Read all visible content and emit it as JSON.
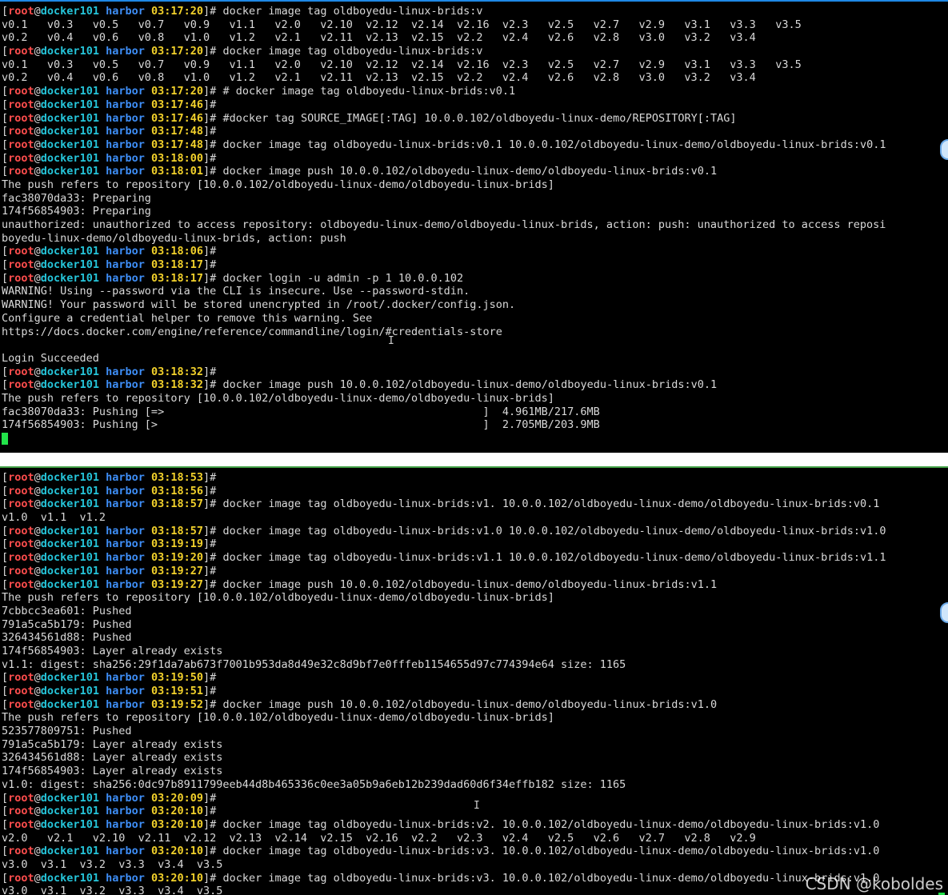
{
  "prompt": {
    "open": "[",
    "user": "root",
    "at": "@",
    "host": "docker101",
    "dir": "harbor",
    "close": "]#"
  },
  "panes": [
    {
      "name": "top",
      "lines": [
        {
          "t": "03:17:20",
          "c": " docker image tag oldboyedu-linux-brids:v"
        },
        {
          "o": "v0.1   v0.3   v0.5   v0.7   v0.9   v1.1   v2.0   v2.10  v2.12  v2.14  v2.16  v2.3   v2.5   v2.7   v2.9   v3.1   v3.3   v3.5"
        },
        {
          "o": "v0.2   v0.4   v0.6   v0.8   v1.0   v1.2   v2.1   v2.11  v2.13  v2.15  v2.2   v2.4   v2.6   v2.8   v3.0   v3.2   v3.4"
        },
        {
          "t": "03:17:20",
          "c": " docker image tag oldboyedu-linux-brids:v"
        },
        {
          "o": "v0.1   v0.3   v0.5   v0.7   v0.9   v1.1   v2.0   v2.10  v2.12  v2.14  v2.16  v2.3   v2.5   v2.7   v2.9   v3.1   v3.3   v3.5"
        },
        {
          "o": "v0.2   v0.4   v0.6   v0.8   v1.0   v1.2   v2.1   v2.11  v2.13  v2.15  v2.2   v2.4   v2.6   v2.8   v3.0   v3.2   v3.4"
        },
        {
          "t": "03:17:20",
          "c": " # docker image tag oldboyedu-linux-brids:v0.1"
        },
        {
          "t": "03:17:46",
          "c": ""
        },
        {
          "t": "03:17:46",
          "c": " #docker tag SOURCE_IMAGE[:TAG] 10.0.0.102/oldboyedu-linux-demo/REPOSITORY[:TAG]"
        },
        {
          "t": "03:17:48",
          "c": ""
        },
        {
          "t": "03:17:48",
          "c": " docker image tag oldboyedu-linux-brids:v0.1 10.0.0.102/oldboyedu-linux-demo/oldboyedu-linux-brids:v0.1"
        },
        {
          "t": "03:18:00",
          "c": ""
        },
        {
          "t": "03:18:01",
          "c": " docker image push 10.0.0.102/oldboyedu-linux-demo/oldboyedu-linux-brids:v0.1"
        },
        {
          "o": "The push refers to repository [10.0.0.102/oldboyedu-linux-demo/oldboyedu-linux-brids]"
        },
        {
          "o": "fac38070da33: Preparing"
        },
        {
          "o": "174f56854903: Preparing"
        },
        {
          "o": "unauthorized: unauthorized to access repository: oldboyedu-linux-demo/oldboyedu-linux-brids, action: push: unauthorized to access reposi"
        },
        {
          "o": "boyedu-linux-demo/oldboyedu-linux-brids, action: push"
        },
        {
          "t": "03:18:06",
          "c": ""
        },
        {
          "t": "03:18:17",
          "c": ""
        },
        {
          "t": "03:18:17",
          "c": " docker login -u admin -p 1 10.0.0.102"
        },
        {
          "o": "WARNING! Using --password via the CLI is insecure. Use --password-stdin."
        },
        {
          "o": "WARNING! Your password will be stored unencrypted in /root/.docker/config.json."
        },
        {
          "o": "Configure a credential helper to remove this warning. See"
        },
        {
          "o": "https://docs.docker.com/engine/reference/commandline/login/#credentials-store"
        },
        {
          "o": ""
        },
        {
          "o": "Login Succeeded"
        },
        {
          "t": "03:18:32",
          "c": ""
        },
        {
          "t": "03:18:32",
          "c": " docker image push 10.0.0.102/oldboyedu-linux-demo/oldboyedu-linux-brids:v0.1"
        },
        {
          "o": "The push refers to repository [10.0.0.102/oldboyedu-linux-demo/oldboyedu-linux-brids]"
        },
        {
          "o": "fac38070da33: Pushing [=>                                                 ]  4.961MB/217.6MB"
        },
        {
          "o": "174f56854903: Pushing [>                                                  ]  2.705MB/203.9MB"
        },
        {
          "cursor": true
        }
      ]
    },
    {
      "name": "bottom",
      "lines": [
        {
          "t": "03:18:53",
          "c": ""
        },
        {
          "t": "03:18:56",
          "c": ""
        },
        {
          "t": "03:18:57",
          "c": " docker image tag oldboyedu-linux-brids:v1. 10.0.0.102/oldboyedu-linux-demo/oldboyedu-linux-brids:v0.1"
        },
        {
          "o": "v1.0  v1.1  v1.2"
        },
        {
          "t": "03:18:57",
          "c": " docker image tag oldboyedu-linux-brids:v1.0 10.0.0.102/oldboyedu-linux-demo/oldboyedu-linux-brids:v1.0"
        },
        {
          "t": "03:19:19",
          "c": ""
        },
        {
          "t": "03:19:20",
          "c": " docker image tag oldboyedu-linux-brids:v1.1 10.0.0.102/oldboyedu-linux-demo/oldboyedu-linux-brids:v1.1"
        },
        {
          "t": "03:19:27",
          "c": ""
        },
        {
          "t": "03:19:27",
          "c": " docker image push 10.0.0.102/oldboyedu-linux-demo/oldboyedu-linux-brids:v1.1"
        },
        {
          "o": "The push refers to repository [10.0.0.102/oldboyedu-linux-demo/oldboyedu-linux-brids]"
        },
        {
          "o": "7cbbcc3ea601: Pushed"
        },
        {
          "o": "791a5ca5b179: Pushed"
        },
        {
          "o": "326434561d88: Pushed"
        },
        {
          "o": "174f56854903: Layer already exists"
        },
        {
          "o": "v1.1: digest: sha256:29f1da7ab673f7001b953da8d49e32c8d9bf7e0fffeb1154655d97c774394e64 size: 1165"
        },
        {
          "t": "03:19:50",
          "c": ""
        },
        {
          "t": "03:19:51",
          "c": ""
        },
        {
          "t": "03:19:52",
          "c": " docker image push 10.0.0.102/oldboyedu-linux-demo/oldboyedu-linux-brids:v1.0"
        },
        {
          "o": "The push refers to repository [10.0.0.102/oldboyedu-linux-demo/oldboyedu-linux-brids]"
        },
        {
          "o": "523577809751: Pushed"
        },
        {
          "o": "791a5ca5b179: Layer already exists"
        },
        {
          "o": "326434561d88: Layer already exists"
        },
        {
          "o": "174f56854903: Layer already exists"
        },
        {
          "o": "v1.0: digest: sha256:0dc97b8911799eeb44d8b465336c0ee3a05b9a6eb12b239dad60d6f34effb182 size: 1165"
        },
        {
          "t": "03:20:09",
          "c": ""
        },
        {
          "t": "03:20:10",
          "c": ""
        },
        {
          "t": "03:20:10",
          "c": " docker image tag oldboyedu-linux-brids:v2. 10.0.0.102/oldboyedu-linux-demo/oldboyedu-linux-brids:v1.0"
        },
        {
          "o": "v2.0   v2.1   v2.10  v2.11  v2.12  v2.13  v2.14  v2.15  v2.16  v2.2   v2.3   v2.4   v2.5   v2.6   v2.7   v2.8   v2.9"
        },
        {
          "t": "03:20:10",
          "c": " docker image tag oldboyedu-linux-brids:v3. 10.0.0.102/oldboyedu-linux-demo/oldboyedu-linux-brids:v1.0"
        },
        {
          "o": "v3.0  v3.1  v3.2  v3.3  v3.4  v3.5"
        },
        {
          "t": "03:20:10",
          "c": " docker image tag oldboyedu-linux-brids:v3. 10.0.0.102/oldboyedu-linux-demo/oldboyedu-linux-brids:v1.0"
        },
        {
          "o": "v3.0  v3.1  v3.2  v3.3  v3.4  v3.5"
        }
      ]
    }
  ],
  "watermark": "CSDN @koboldes",
  "colors": {
    "user": "#ff4d4d",
    "host": "#25c4d9",
    "dir": "#3e8ef7",
    "time": "#f2d12b",
    "text": "#d9d9d9",
    "cursor": "#22e34a"
  }
}
